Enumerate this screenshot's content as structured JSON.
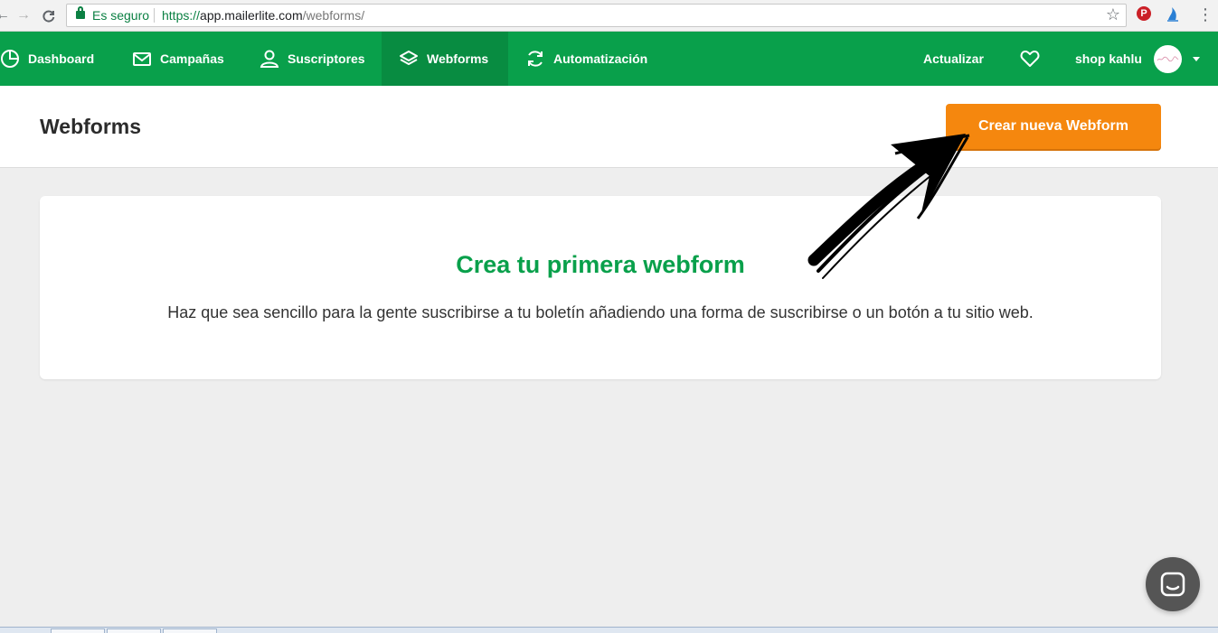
{
  "browser": {
    "secure_label": "Es seguro",
    "url_scheme": "https://",
    "url_host": "app.mailerlite.com",
    "url_path": "/webforms/",
    "icons": [
      "back-icon",
      "forward-icon",
      "reload-icon",
      "lock-icon",
      "star-icon",
      "pinterest-icon",
      "extension-icon",
      "menu-dots-icon"
    ]
  },
  "nav": {
    "items": [
      {
        "label": "Dashboard",
        "icon": "clock-pie-icon"
      },
      {
        "label": "Campañas",
        "icon": "envelope-icon"
      },
      {
        "label": "Suscriptores",
        "icon": "user-icon"
      },
      {
        "label": "Webforms",
        "icon": "layers-icon",
        "active": true
      },
      {
        "label": "Automatización",
        "icon": "refresh-icon"
      }
    ],
    "update_label": "Actualizar",
    "account_name": "shop kahlu",
    "brand_color": "#09a04b"
  },
  "header": {
    "title": "Webforms",
    "create_button": "Crear nueva Webform",
    "button_color": "#f5870e"
  },
  "empty_state": {
    "title": "Crea tu primera webform",
    "description": "Haz que sea sencillo para la gente suscribirse a tu boletín añadiendo una forma de suscribirse o un botón a tu sitio web."
  }
}
